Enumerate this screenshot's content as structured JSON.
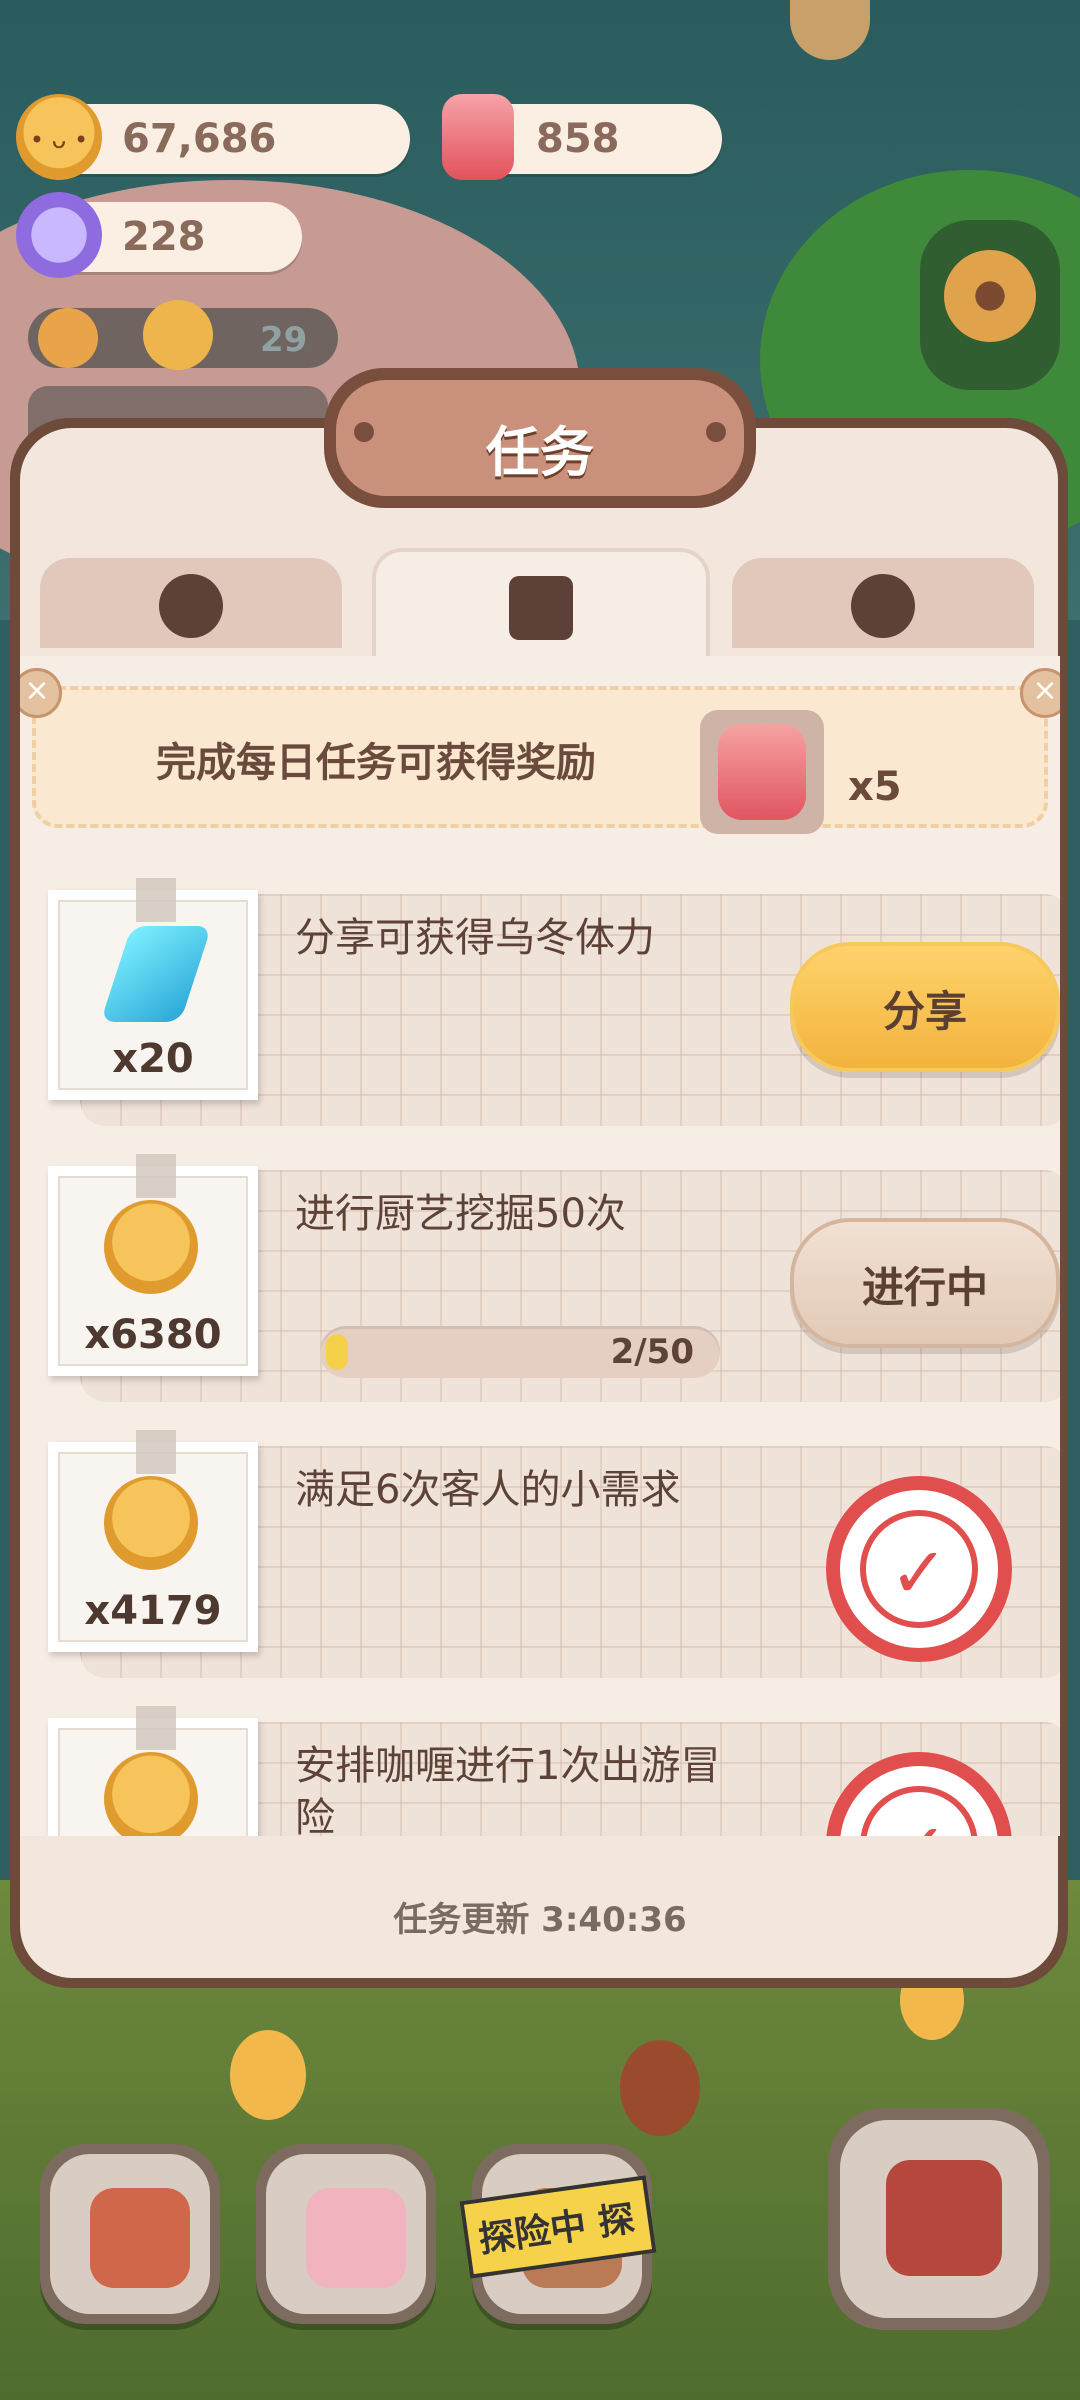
{
  "resources": {
    "cookies": "67,686",
    "candles": "858",
    "candy": "228"
  },
  "notice": {
    "count": "29"
  },
  "panel": {
    "title": "任务",
    "tabs": [
      {
        "icon": "paw-badge-icon"
      },
      {
        "icon": "task-note-icon"
      },
      {
        "icon": "jar-heart-icon"
      }
    ],
    "banner": {
      "text": "完成每日任务可获得奖励",
      "reward_icon": "candle-icon",
      "reward_count": "x5"
    },
    "tasks": [
      {
        "title": "分享可获得乌冬体力",
        "reward_icon": "lightning-icon",
        "reward": "x20",
        "button": "分享",
        "status": "action"
      },
      {
        "title": "进行厨艺挖掘50次",
        "reward_icon": "cookie-icon",
        "reward": "x6380",
        "button": "进行中",
        "status": "in-progress",
        "progress_text": "2/50",
        "progress": 0.04
      },
      {
        "title": "满足6次客人的小需求",
        "reward_icon": "cookie-icon",
        "reward": "x4179",
        "status": "done"
      },
      {
        "title": "安排咖喱进行1次出游冒险",
        "reward_icon": "cookie-icon",
        "status": "done"
      }
    ],
    "footer": "任务更新 3:40:36"
  },
  "bottom_nav": {
    "explore_label": "探险中 探"
  },
  "colors": {
    "accent_yellow": "#f2b33d",
    "stamp_red": "#e14e4e",
    "panel_bg": "#f3e6dc"
  }
}
